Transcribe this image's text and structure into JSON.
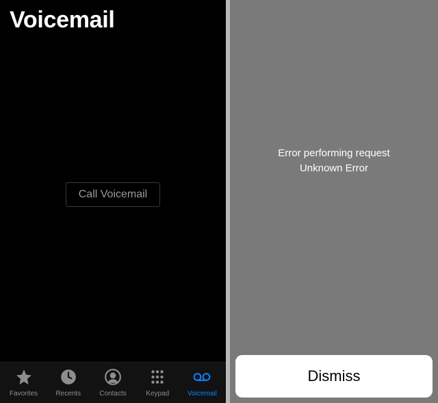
{
  "left": {
    "title": "Voicemail",
    "call_button": "Call Voicemail",
    "tabs": [
      {
        "label": "Favorites"
      },
      {
        "label": "Recents"
      },
      {
        "label": "Contacts"
      },
      {
        "label": "Keypad"
      },
      {
        "label": "Voicemail"
      }
    ],
    "active_tab_index": 4
  },
  "right": {
    "error_line1": "Error performing request",
    "error_line2": "Unknown Error",
    "dismiss_label": "Dismiss"
  },
  "colors": {
    "accent": "#0a84ff",
    "inactive": "#8e8e8e",
    "divider": "#b8b8b8",
    "right_bg": "#7a7a7a"
  }
}
